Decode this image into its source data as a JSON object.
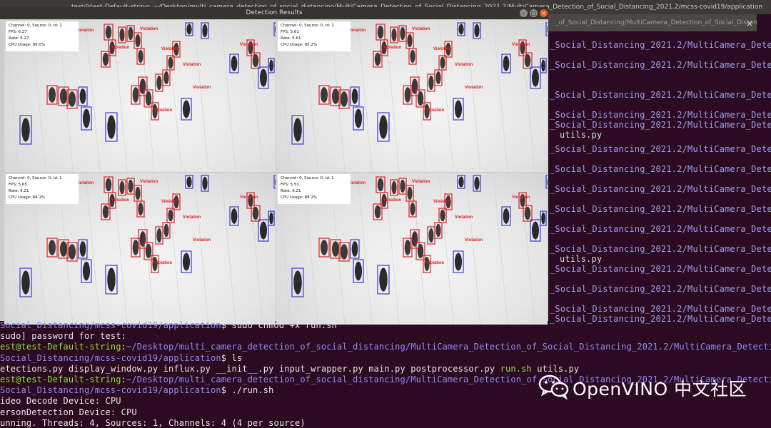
{
  "terminal": {
    "title": "test@test-Default-string: ~/Desktop/multi_camera_detection_of_social_distancing/MultiCamera_Detection_of_Social_Distancing_2021.2/MultiCamera_Detection_of_Social_Distancing_2021.2/mcss-covid19/application",
    "tab_title": "_of_Social_Distancing/MultiCamera_Detection_of_Social_Distanc",
    "right_lines": [
      "_Social_Distancing_2021.2/MultiCamera_Detection_of",
      "_Social_Distancing_2021.2/MultiCamera_Detection_of",
      "_Social_Distancing_2021.2/MultiCamera_Detection_of",
      "_Social_Distancing_2021.2/MultiCamera_Detection_of",
      "_Social_Distancing_2021.2/MultiCamera_Detection_of",
      "utils.py",
      "_Social_Distancing_2021.2/MultiCamera_Detection_of",
      "_Social_Distancing_2021.2/MultiCamera_Detection_of",
      "_Social_Distancing_2021.2/MultiCamera_Detection_of",
      "_Social_Distancing_2021.2/MultiCamera_Detection_of",
      "_Social_Distancing_2021.2/MultiCamera_Detection_of",
      "_Social_Distancing_2021.2/MultiCamera_Detection_of",
      "utils.py",
      "_Social_Distancing_2021.2/MultiCamera_Detection_of",
      "_Social_Distancing_2021.2/MultiCamera_Detection_of",
      "_Social_Distancing_2021.2/MultiCamera_Detection_of",
      "_Social_Distancing_2021.2/MultiCamera_Detection_of"
    ],
    "output": [
      {
        "segments": [
          {
            "text": "Social_Distancing/mcss-covid19/application",
            "color": "blue"
          },
          {
            "text": "$ sudo chmod +x run.sh",
            "color": "white"
          }
        ]
      },
      {
        "segments": [
          {
            "text": "sudo] password for test:",
            "color": "white"
          }
        ]
      },
      {
        "segments": [
          {
            "text": "est@test-Default-string",
            "color": "green"
          },
          {
            "text": ":",
            "color": "white"
          },
          {
            "text": "~/Desktop/multi_camera_detection_of_social_distancing/MultiCamera_Detection_of_Social_Distancing_2021.2/MultiCamera_Detection_of",
            "color": "blue"
          }
        ]
      },
      {
        "segments": [
          {
            "text": "Social_Distancing/mcss-covid19/application",
            "color": "blue"
          },
          {
            "text": "$ ls",
            "color": "white"
          }
        ]
      },
      {
        "segments": [
          {
            "text": "etections.py  display_window.py  influx.py  __init__.py  input_wrapper.py  main.py  postprocessor.py  ",
            "color": "white"
          },
          {
            "text": "run.sh",
            "color": "green"
          },
          {
            "text": "  utils.py",
            "color": "white"
          }
        ]
      },
      {
        "segments": [
          {
            "text": "est@test-Default-string",
            "color": "green"
          },
          {
            "text": ":",
            "color": "white"
          },
          {
            "text": "~/Desktop/multi_camera_detection_of_social_distancing/MultiCamera_Detection_of_Social_Distancing_2021.2/MultiCamera_Detection_of",
            "color": "blue"
          }
        ]
      },
      {
        "segments": [
          {
            "text": "Social_Distancing/mcss-covid19/application",
            "color": "blue"
          },
          {
            "text": "$ ./run.sh",
            "color": "white"
          }
        ]
      },
      {
        "segments": [
          {
            "text": "ideo Decode Device: CPU",
            "color": "white"
          }
        ]
      },
      {
        "segments": [
          {
            "text": "ersonDetection Device: CPU",
            "color": "white"
          }
        ]
      },
      {
        "segments": [
          {
            "text": "unning. Threads: 4, Sources: 1, Channels: 4 (4 per source)",
            "color": "white"
          }
        ]
      }
    ]
  },
  "detection_window": {
    "title": "Detection Results",
    "buttons": {
      "minimize": "–",
      "maximize": "□",
      "close": "×"
    },
    "violation_label": "Violation",
    "panels": [
      {
        "lines": [
          "Channel: 0, Source: 0, id: 1",
          "FPS: 6.27",
          "Rate: 6.27",
          "CPU Usage: 89.0%"
        ]
      },
      {
        "lines": [
          "Channel: 0, Source: 0, id: 1",
          "FPS: 5.61",
          "Rate: 5.61",
          "CPU Usage: 85.2%"
        ]
      },
      {
        "lines": [
          "Channel: 0, Source: 0, id: 1",
          "FPS: 5.65",
          "Rate: 6.21",
          "CPU Usage: 84.1%"
        ]
      },
      {
        "lines": [
          "Channel: 0, Source: 0, id: 1",
          "FPS: 5.51",
          "Rate: 6.21",
          "CPU Usage: 88.2%"
        ]
      }
    ]
  },
  "watermark": {
    "icon": "wechat-icon",
    "text": "OpenVINO 中文社区"
  },
  "colors": {
    "terminal_bg": "#2c0a22",
    "violation": "#e02020",
    "safe": "#3a3ae0"
  }
}
